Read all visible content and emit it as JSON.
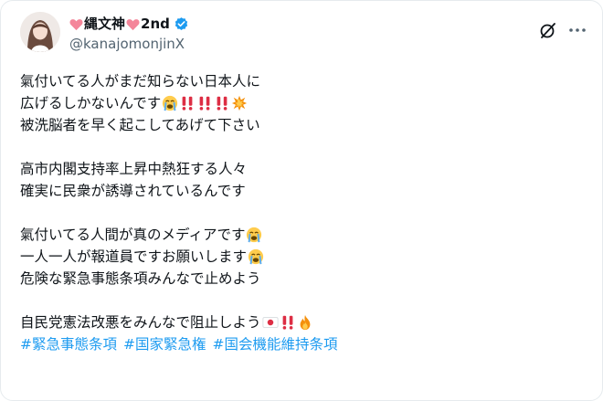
{
  "post": {
    "author": {
      "display_name": "縄文神",
      "display_suffix": "2nd",
      "handle": "@kanajomonjinX",
      "verified": true
    },
    "lines": [
      "氣付いてる人がまだ知らない日本人に",
      "広げるしかないんです",
      "被洗脳者を早く起こしてあげて下さい",
      "",
      "高市内閣支持率上昇中熱狂する人々",
      "確実に民衆が誘導されているんです",
      "",
      "氣付いてる人間が真のメディアです",
      "一人一人が報道員ですお願いします",
      "危険な緊急事態条項みんなで止めよう",
      "",
      "自民党憲法改悪をみんなで阻止しよう"
    ],
    "hashtags": [
      "#緊急事態条項",
      "#国家緊急権",
      "#国会機能維持条項"
    ],
    "emoji": {
      "line2": [
        "loudly-crying-face",
        "double-exclamation",
        "double-exclamation",
        "double-exclamation",
        "collision"
      ],
      "line8": [
        "loudly-crying-face"
      ],
      "line9": [
        "loudly-crying-face"
      ],
      "line12": [
        "japan-flag",
        "double-exclamation",
        "fire"
      ]
    }
  },
  "icons": {
    "header": [
      "grok-icon",
      "more-options-icon"
    ]
  },
  "colors": {
    "link": "#1d9bf0",
    "text": "#0f1419",
    "muted": "#536471",
    "verified": "#1d9bf0",
    "heart": "#f4869a"
  }
}
